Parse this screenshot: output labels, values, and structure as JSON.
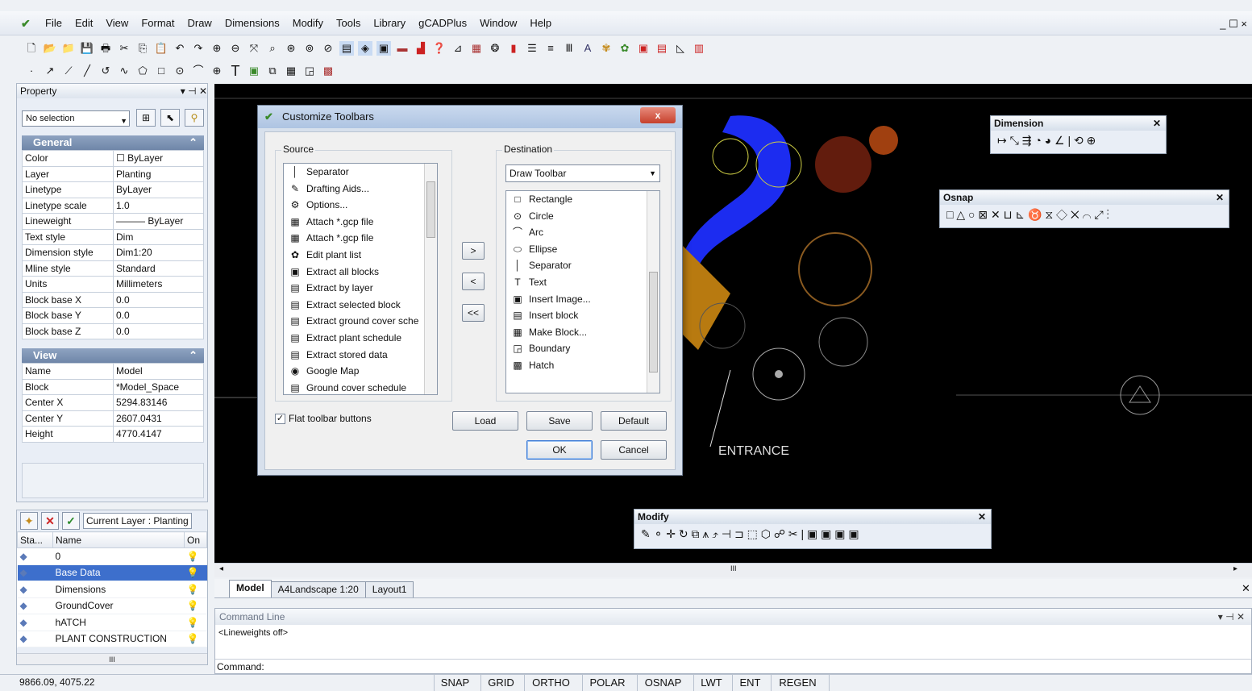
{
  "menu": [
    "File",
    "Edit",
    "View",
    "Format",
    "Draw",
    "Dimensions",
    "Modify",
    "Tools",
    "Library",
    "gCADPlus",
    "Window",
    "Help"
  ],
  "window_controls": "_ ☐ ×",
  "property_panel": {
    "title": "Property",
    "selection": "No selection",
    "sections": {
      "general": {
        "label": "General",
        "rows": [
          {
            "k": "Color",
            "v": "☐ ByLayer"
          },
          {
            "k": "Layer",
            "v": "Planting"
          },
          {
            "k": "Linetype",
            "v": "ByLayer"
          },
          {
            "k": "Linetype scale",
            "v": "1.0"
          },
          {
            "k": "Lineweight",
            "v": "——— ByLayer"
          },
          {
            "k": "Text style",
            "v": "Dim"
          },
          {
            "k": "Dimension style",
            "v": "Dim1:20"
          },
          {
            "k": "Mline style",
            "v": "Standard"
          },
          {
            "k": "Units",
            "v": "Millimeters"
          },
          {
            "k": "Block base X",
            "v": "0.0"
          },
          {
            "k": "Block base Y",
            "v": "0.0"
          },
          {
            "k": "Block base Z",
            "v": "0.0"
          }
        ]
      },
      "view": {
        "label": "View",
        "rows": [
          {
            "k": "Name",
            "v": "Model"
          },
          {
            "k": "Block",
            "v": "*Model_Space"
          },
          {
            "k": "Center X",
            "v": "5294.83146"
          },
          {
            "k": "Center Y",
            "v": "2607.0431"
          },
          {
            "k": "Height",
            "v": "4770.4147"
          }
        ]
      }
    }
  },
  "layer_panel": {
    "current_layer": "Current Layer : Planting",
    "headers": {
      "status": "Sta...",
      "name": "Name",
      "on": "On"
    },
    "rows": [
      {
        "name": "0",
        "selected": false
      },
      {
        "name": "Base Data",
        "selected": true
      },
      {
        "name": "Dimensions",
        "selected": false
      },
      {
        "name": "GroundCover",
        "selected": false
      },
      {
        "name": "hATCH",
        "selected": false
      },
      {
        "name": "PLANT CONSTRUCTION",
        "selected": false
      }
    ]
  },
  "dialog": {
    "title": "Customize Toolbars",
    "close": "x",
    "source_label": "Source",
    "destination_label": "Destination",
    "destination_select": "Draw Toolbar",
    "source_items": [
      {
        "icon": "│",
        "label": "Separator"
      },
      {
        "icon": "✎",
        "label": "Drafting Aids..."
      },
      {
        "icon": "⚙",
        "label": "Options..."
      },
      {
        "icon": "▦",
        "label": "Attach *.gcp file"
      },
      {
        "icon": "▦",
        "label": "Attach *.gcp file"
      },
      {
        "icon": "✿",
        "label": "Edit plant list"
      },
      {
        "icon": "▣",
        "label": "Extract all blocks"
      },
      {
        "icon": "▤",
        "label": "Extract by layer"
      },
      {
        "icon": "▤",
        "label": "Extract selected block"
      },
      {
        "icon": "▤",
        "label": "Extract ground cover sche"
      },
      {
        "icon": "▤",
        "label": "Extract plant schedule"
      },
      {
        "icon": "▤",
        "label": "Extract stored data"
      },
      {
        "icon": "◉",
        "label": "Google Map"
      },
      {
        "icon": "▤",
        "label": "Ground cover schedule"
      }
    ],
    "dest_items": [
      {
        "icon": "□",
        "label": "Rectangle"
      },
      {
        "icon": "⊙",
        "label": "Circle"
      },
      {
        "icon": "⌒",
        "label": "Arc"
      },
      {
        "icon": "⬭",
        "label": "Ellipse"
      },
      {
        "icon": "│",
        "label": "Separator"
      },
      {
        "icon": "T",
        "label": "Text"
      },
      {
        "icon": "▣",
        "label": "Insert Image..."
      },
      {
        "icon": "▤",
        "label": "Insert block"
      },
      {
        "icon": "▦",
        "label": "Make Block..."
      },
      {
        "icon": "◲",
        "label": "Boundary"
      },
      {
        "icon": "▩",
        "label": "Hatch"
      }
    ],
    "move_buttons": [
      ">",
      "<",
      "<<"
    ],
    "flat_toolbar": "Flat toolbar buttons",
    "buttons": {
      "load": "Load",
      "save": "Save",
      "default": "Default",
      "ok": "OK",
      "cancel": "Cancel"
    }
  },
  "floating": {
    "dimension": {
      "title": "Dimension",
      "icons": "↦ ⤡ ⇶ ◔ ◕ ∠ | ⟲ ⊕"
    },
    "osnap": {
      "title": "Osnap",
      "icons": "□ △ ○ ⊠ ✕ ⊔ ⊾ ♉ ⧖ ◇ ✕ ⌒ ⤢ ⋮"
    },
    "modify": {
      "title": "Modify",
      "icons": "✎ ⚬ ✛ ↻ ⧉ ⩚ ⤴ ⊣ ⊐ ⬚ ⬡ ☍ ✂ | ▣ ▣ ▣ ▣"
    }
  },
  "drawing_label": "ENTRANCE",
  "scroll_label": "III",
  "tabs": [
    "Model",
    "A4Landscape 1:20",
    "Layout1"
  ],
  "command": {
    "title": "Command Line",
    "history": "<Lineweights off>",
    "prompt": "Command:"
  },
  "status": {
    "coords": "9866.09, 4075.22",
    "buttons": [
      "SNAP",
      "GRID",
      "ORTHO",
      "POLAR",
      "OSNAP",
      "LWT",
      "ENT",
      "REGEN"
    ]
  }
}
